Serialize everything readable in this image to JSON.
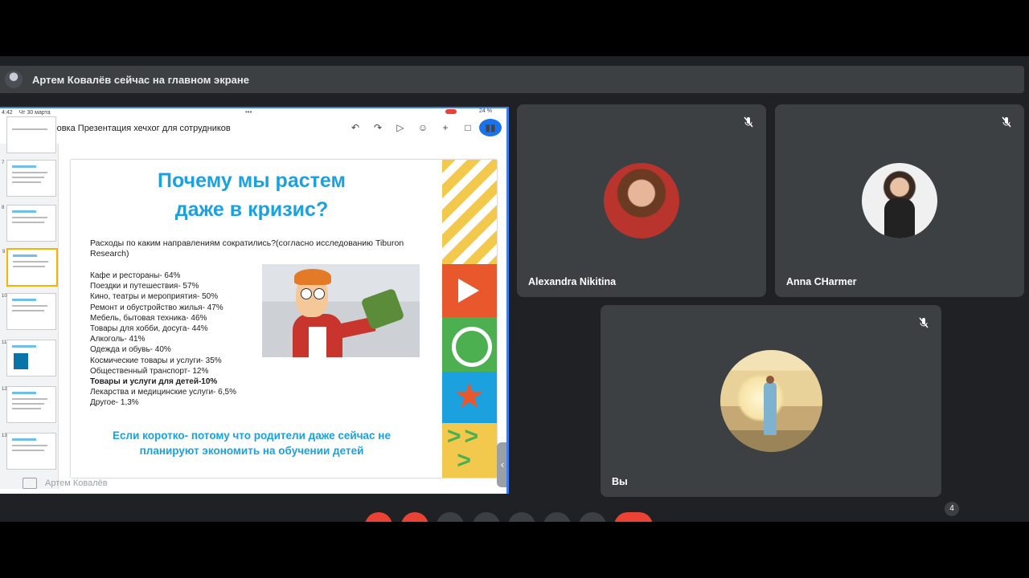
{
  "banner": {
    "text": "Артем Ковалёв сейчас на главном экране"
  },
  "device": {
    "time": "4:42",
    "date": "Чт 30 марта",
    "battery": "24 %"
  },
  "doc": {
    "title": "Стажировка Презентация хечхог для сотрудников"
  },
  "thumbnails": [
    "7",
    "8",
    "9",
    "10",
    "11",
    "12",
    "13"
  ],
  "slide": {
    "title_line1": "Почему мы растем",
    "title_line2": "даже в кризис?",
    "intro": "Расходы по каким направлениям сократились?(согласно исследованию Tiburon Research)",
    "items": [
      "Кафе и рестораны- 64%",
      "Поездки и путешествия- 57%",
      "Кино, театры и мероприятия- 50%",
      "Ремонт и обустройство жилья- 47%",
      "Мебель, бытовая техника- 46%",
      "Товары для хобби, досуга- 44%",
      "Алкоголь- 41%",
      "Одежда и обувь- 40%",
      "Космические товары и услуги- 35%",
      "Общественный транспорт- 12%",
      "Товары и услуги для детей-10%",
      "Лекарства и медицинские услуги- 6,5%",
      "Другое- 1,3%"
    ],
    "footer_line1": "Если коротко- потому что родители даже сейчас не",
    "footer_line2": "планируют экономить на обучении детей"
  },
  "presenter": {
    "name": "Артем Ковалёв"
  },
  "participants": [
    {
      "name": "Alexandra Nikitina",
      "muted": true
    },
    {
      "name": "Anna CHarmer",
      "muted": true
    },
    {
      "name": "Вы",
      "muted": true
    }
  ],
  "bottom": {
    "participant_count": "4"
  },
  "colors": {
    "accent": "#1aa1de",
    "meet_bg": "#202124",
    "tile_bg": "#3c4043",
    "end_call": "#ea4335",
    "share_border": "#3b7cf0"
  }
}
